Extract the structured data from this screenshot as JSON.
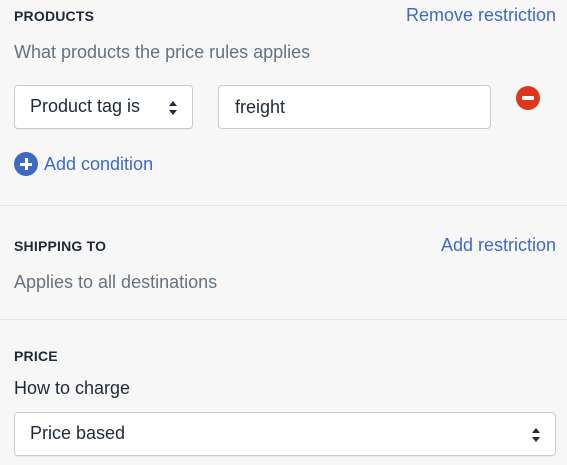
{
  "products": {
    "heading": "PRODUCTS",
    "action": "Remove restriction",
    "description": "What products the price rules applies",
    "condition": {
      "field_select": "Product tag is",
      "value_input": "freight"
    },
    "add_condition": "Add condition"
  },
  "shipping": {
    "heading": "SHIPPING TO",
    "action": "Add restriction",
    "description": "Applies to all destinations"
  },
  "price": {
    "heading": "PRICE",
    "label": "How to charge",
    "select_value": "Price based"
  },
  "icons": {
    "remove": "minus-circle-icon",
    "add": "plus-circle-icon",
    "select": "select-arrows-icon"
  },
  "colors": {
    "link": "#3f6ac4",
    "danger": "#de3618",
    "background": "#f7f7f8",
    "text": "#212b36",
    "subdued": "#637381"
  }
}
